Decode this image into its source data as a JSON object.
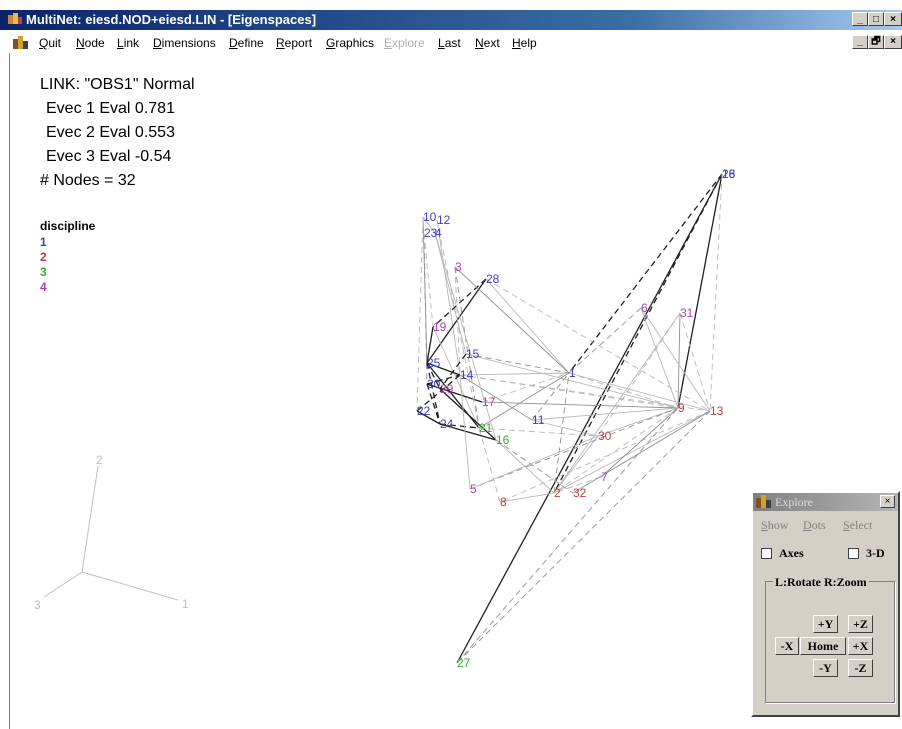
{
  "window": {
    "title": "MultiNet: eiesd.NOD+eiesd.LIN - [Eigenspaces]",
    "buttons": [
      "_",
      "□",
      "×"
    ]
  },
  "menubar": {
    "items": [
      {
        "label": "Quit",
        "enabled": true
      },
      {
        "label": "Node",
        "enabled": true
      },
      {
        "label": "Link",
        "enabled": true
      },
      {
        "label": "Dimensions",
        "enabled": true
      },
      {
        "label": "Define",
        "enabled": true
      },
      {
        "label": "Report",
        "enabled": true
      },
      {
        "label": "Graphics",
        "enabled": true
      },
      {
        "label": "Explore",
        "enabled": false
      },
      {
        "label": "Last",
        "enabled": true
      },
      {
        "label": "Next",
        "enabled": true
      },
      {
        "label": "Help",
        "enabled": true
      }
    ],
    "mdi_buttons": [
      "_",
      "🗗",
      "×"
    ]
  },
  "info": {
    "link_line": "LINK: \"OBS1\" Normal",
    "evec1": "Evec 1 Eval  0.781",
    "evec2": "Evec 2 Eval  0.553",
    "evec3": "Evec 3 Eval  -0.54",
    "nodes": "# Nodes = 32"
  },
  "legend": {
    "title": "discipline",
    "items": [
      {
        "label": "1",
        "color": "#4040c0"
      },
      {
        "label": "2",
        "color": "#c04040"
      },
      {
        "label": "3",
        "color": "#30b030"
      },
      {
        "label": "4",
        "color": "#b040b0"
      }
    ]
  },
  "axes_gizmo": {
    "labels": [
      "1",
      "2",
      "3"
    ],
    "color": "#c0c0c0"
  },
  "network": {
    "colors": {
      "1": "#4040c0",
      "2": "#c04040",
      "3": "#30b030",
      "4": "#b040b0"
    },
    "nodes": [
      {
        "id": "10",
        "group": "1"
      },
      {
        "id": "12",
        "group": "1"
      },
      {
        "id": "23",
        "group": "1"
      },
      {
        "id": "4",
        "group": "1"
      },
      {
        "id": "3",
        "group": "4"
      },
      {
        "id": "28",
        "group": "1"
      },
      {
        "id": "26",
        "group": "1"
      },
      {
        "id": "18",
        "group": "1"
      },
      {
        "id": "6",
        "group": "4"
      },
      {
        "id": "31",
        "group": "4"
      },
      {
        "id": "19",
        "group": "4"
      },
      {
        "id": "15",
        "group": "1"
      },
      {
        "id": "25",
        "group": "1"
      },
      {
        "id": "14",
        "group": "1"
      },
      {
        "id": "1",
        "group": "1"
      },
      {
        "id": "20",
        "group": "1"
      },
      {
        "id": "29",
        "group": "4"
      },
      {
        "id": "17",
        "group": "4"
      },
      {
        "id": "9",
        "group": "2"
      },
      {
        "id": "13",
        "group": "2"
      },
      {
        "id": "22",
        "group": "1"
      },
      {
        "id": "11",
        "group": "1"
      },
      {
        "id": "24",
        "group": "1"
      },
      {
        "id": "21",
        "group": "3"
      },
      {
        "id": "16",
        "group": "3"
      },
      {
        "id": "30",
        "group": "2"
      },
      {
        "id": "7",
        "group": "4"
      },
      {
        "id": "5",
        "group": "4"
      },
      {
        "id": "2",
        "group": "2"
      },
      {
        "id": "32",
        "group": "2"
      },
      {
        "id": "8",
        "group": "2"
      },
      {
        "id": "27",
        "group": "3"
      }
    ]
  },
  "explore_panel": {
    "title": "Explore",
    "close": "×",
    "menu": [
      "Show",
      "Dots",
      "Select"
    ],
    "axes_label": "Axes",
    "axes_checked": false,
    "threed_label": "3-D",
    "threed_checked": false,
    "group_label": "L:Rotate  R:Zoom",
    "buttons": {
      "plus_y": "+Y",
      "plus_z": "+Z",
      "minus_x": "-X",
      "home": "Home",
      "plus_x": "+X",
      "minus_y": "-Y",
      "minus_z": "-Z"
    }
  }
}
